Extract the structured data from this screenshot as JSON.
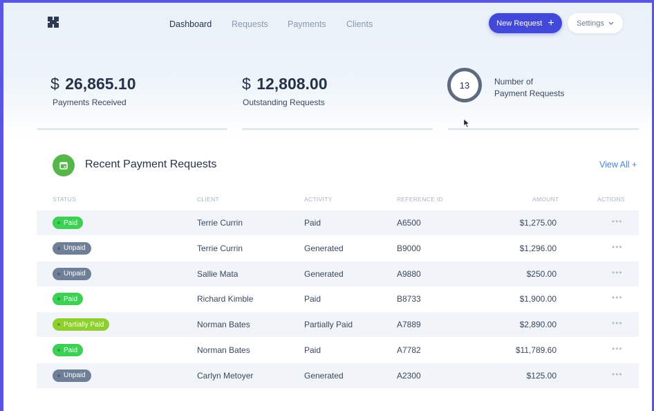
{
  "nav": {
    "links": [
      "Dashboard",
      "Requests",
      "Payments",
      "Clients"
    ],
    "new_request_label": "New Request",
    "settings_label": "Settings"
  },
  "stats": {
    "payments_received": {
      "currency": "$",
      "amount": "26,865.10",
      "label": "Payments Received"
    },
    "outstanding": {
      "currency": "$",
      "amount": "12,808.00",
      "label": "Outstanding Requests"
    },
    "requests_count": {
      "value": "13",
      "label_line1": "Number of",
      "label_line2": "Payment Requests"
    }
  },
  "section": {
    "title": "Recent Payment Requests",
    "view_all": "View All +"
  },
  "table": {
    "headers": [
      "STATUS",
      "CLIENT",
      "ACTIVITY",
      "REFERENCE ID",
      "AMOUNT",
      "ACTIONS"
    ],
    "rows": [
      {
        "status": "Paid",
        "status_kind": "paid",
        "client": "Terrie Currin",
        "activity": "Paid",
        "ref": "A6500",
        "amount": "$1,275.00",
        "actions": "•••"
      },
      {
        "status": "Unpaid",
        "status_kind": "unpaid",
        "client": "Terrie Currin",
        "activity": "Generated",
        "ref": "B9000",
        "amount": "$1,296.00",
        "actions": "•••"
      },
      {
        "status": "Unpaid",
        "status_kind": "unpaid",
        "client": "Sallie Mata",
        "activity": "Generated",
        "ref": "A9880",
        "amount": "$250.00",
        "actions": "•••"
      },
      {
        "status": "Paid",
        "status_kind": "paid",
        "client": "Richard Kimble",
        "activity": "Paid",
        "ref": "B8733",
        "amount": "$1,900.00",
        "actions": "•••"
      },
      {
        "status": "Partially Paid",
        "status_kind": "partial",
        "client": "Norman Bates",
        "activity": "Partially Paid",
        "ref": "A7889",
        "amount": "$2,890.00",
        "actions": "•••"
      },
      {
        "status": "Paid",
        "status_kind": "paid",
        "client": "Norman Bates",
        "activity": "Paid",
        "ref": "A7782",
        "amount": "$11,789.60",
        "actions": "•••"
      },
      {
        "status": "Unpaid",
        "status_kind": "unpaid",
        "client": "Carlyn Metoyer",
        "activity": "Generated",
        "ref": "A2300",
        "amount": "$125.00",
        "actions": "•••"
      }
    ]
  },
  "colors": {
    "accent": "#4248d8",
    "paid": "#3ecf55",
    "unpaid": "#6f7f98",
    "partial": "#8ccf2f",
    "section_icon": "#55b64a",
    "link": "#4a82d8"
  },
  "icons": {
    "logo": "logo-icon",
    "new_request": "plus-icon",
    "settings": "chevron-down-icon",
    "section": "calendar-icon",
    "cursor": "mouse-cursor-icon",
    "actions": "more-dots-icon"
  }
}
